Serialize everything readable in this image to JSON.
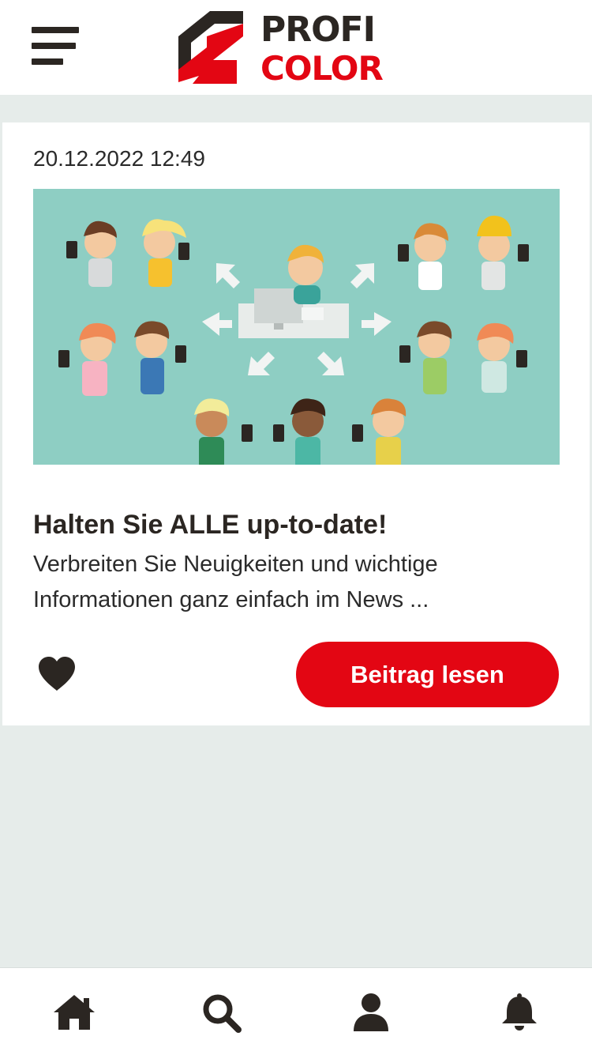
{
  "header": {
    "menu_icon": "hamburger-menu-icon",
    "logo": {
      "line1": "PROFI",
      "line2": "COLOR",
      "colors": {
        "dark": "#2b2622",
        "accent": "#e30613"
      }
    }
  },
  "post": {
    "date": "20.12.2022 12:49",
    "image_alt": "",
    "title": "Halten Sie ALLE up-to-date!",
    "excerpt": "Verbreiten Sie Neuigkeiten und wichtige Informationen ganz einfach im News ...",
    "like_icon": "heart-icon",
    "read_button_label": "Beitrag lesen"
  },
  "bottom_nav": {
    "items": [
      {
        "icon": "home-icon"
      },
      {
        "icon": "search-icon"
      },
      {
        "icon": "user-icon"
      },
      {
        "icon": "bell-icon"
      }
    ]
  },
  "colors": {
    "background": "#e6ecea",
    "card": "#ffffff",
    "accent": "#e30613",
    "text": "#2b2b2b",
    "illustration_bg": "#8ecec3"
  }
}
